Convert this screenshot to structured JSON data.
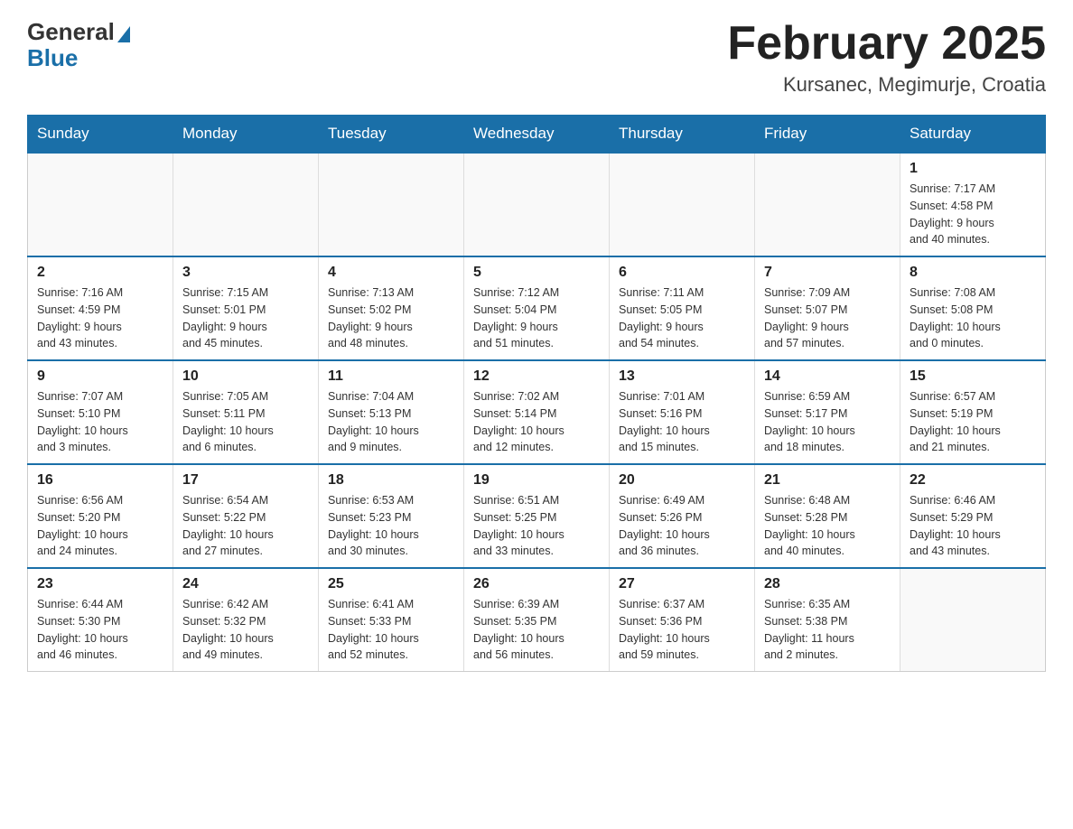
{
  "header": {
    "logo_general": "General",
    "logo_blue": "Blue",
    "title": "February 2025",
    "location": "Kursanec, Megimurje, Croatia"
  },
  "weekdays": [
    "Sunday",
    "Monday",
    "Tuesday",
    "Wednesday",
    "Thursday",
    "Friday",
    "Saturday"
  ],
  "weeks": [
    [
      {
        "day": "",
        "info": ""
      },
      {
        "day": "",
        "info": ""
      },
      {
        "day": "",
        "info": ""
      },
      {
        "day": "",
        "info": ""
      },
      {
        "day": "",
        "info": ""
      },
      {
        "day": "",
        "info": ""
      },
      {
        "day": "1",
        "info": "Sunrise: 7:17 AM\nSunset: 4:58 PM\nDaylight: 9 hours\nand 40 minutes."
      }
    ],
    [
      {
        "day": "2",
        "info": "Sunrise: 7:16 AM\nSunset: 4:59 PM\nDaylight: 9 hours\nand 43 minutes."
      },
      {
        "day": "3",
        "info": "Sunrise: 7:15 AM\nSunset: 5:01 PM\nDaylight: 9 hours\nand 45 minutes."
      },
      {
        "day": "4",
        "info": "Sunrise: 7:13 AM\nSunset: 5:02 PM\nDaylight: 9 hours\nand 48 minutes."
      },
      {
        "day": "5",
        "info": "Sunrise: 7:12 AM\nSunset: 5:04 PM\nDaylight: 9 hours\nand 51 minutes."
      },
      {
        "day": "6",
        "info": "Sunrise: 7:11 AM\nSunset: 5:05 PM\nDaylight: 9 hours\nand 54 minutes."
      },
      {
        "day": "7",
        "info": "Sunrise: 7:09 AM\nSunset: 5:07 PM\nDaylight: 9 hours\nand 57 minutes."
      },
      {
        "day": "8",
        "info": "Sunrise: 7:08 AM\nSunset: 5:08 PM\nDaylight: 10 hours\nand 0 minutes."
      }
    ],
    [
      {
        "day": "9",
        "info": "Sunrise: 7:07 AM\nSunset: 5:10 PM\nDaylight: 10 hours\nand 3 minutes."
      },
      {
        "day": "10",
        "info": "Sunrise: 7:05 AM\nSunset: 5:11 PM\nDaylight: 10 hours\nand 6 minutes."
      },
      {
        "day": "11",
        "info": "Sunrise: 7:04 AM\nSunset: 5:13 PM\nDaylight: 10 hours\nand 9 minutes."
      },
      {
        "day": "12",
        "info": "Sunrise: 7:02 AM\nSunset: 5:14 PM\nDaylight: 10 hours\nand 12 minutes."
      },
      {
        "day": "13",
        "info": "Sunrise: 7:01 AM\nSunset: 5:16 PM\nDaylight: 10 hours\nand 15 minutes."
      },
      {
        "day": "14",
        "info": "Sunrise: 6:59 AM\nSunset: 5:17 PM\nDaylight: 10 hours\nand 18 minutes."
      },
      {
        "day": "15",
        "info": "Sunrise: 6:57 AM\nSunset: 5:19 PM\nDaylight: 10 hours\nand 21 minutes."
      }
    ],
    [
      {
        "day": "16",
        "info": "Sunrise: 6:56 AM\nSunset: 5:20 PM\nDaylight: 10 hours\nand 24 minutes."
      },
      {
        "day": "17",
        "info": "Sunrise: 6:54 AM\nSunset: 5:22 PM\nDaylight: 10 hours\nand 27 minutes."
      },
      {
        "day": "18",
        "info": "Sunrise: 6:53 AM\nSunset: 5:23 PM\nDaylight: 10 hours\nand 30 minutes."
      },
      {
        "day": "19",
        "info": "Sunrise: 6:51 AM\nSunset: 5:25 PM\nDaylight: 10 hours\nand 33 minutes."
      },
      {
        "day": "20",
        "info": "Sunrise: 6:49 AM\nSunset: 5:26 PM\nDaylight: 10 hours\nand 36 minutes."
      },
      {
        "day": "21",
        "info": "Sunrise: 6:48 AM\nSunset: 5:28 PM\nDaylight: 10 hours\nand 40 minutes."
      },
      {
        "day": "22",
        "info": "Sunrise: 6:46 AM\nSunset: 5:29 PM\nDaylight: 10 hours\nand 43 minutes."
      }
    ],
    [
      {
        "day": "23",
        "info": "Sunrise: 6:44 AM\nSunset: 5:30 PM\nDaylight: 10 hours\nand 46 minutes."
      },
      {
        "day": "24",
        "info": "Sunrise: 6:42 AM\nSunset: 5:32 PM\nDaylight: 10 hours\nand 49 minutes."
      },
      {
        "day": "25",
        "info": "Sunrise: 6:41 AM\nSunset: 5:33 PM\nDaylight: 10 hours\nand 52 minutes."
      },
      {
        "day": "26",
        "info": "Sunrise: 6:39 AM\nSunset: 5:35 PM\nDaylight: 10 hours\nand 56 minutes."
      },
      {
        "day": "27",
        "info": "Sunrise: 6:37 AM\nSunset: 5:36 PM\nDaylight: 10 hours\nand 59 minutes."
      },
      {
        "day": "28",
        "info": "Sunrise: 6:35 AM\nSunset: 5:38 PM\nDaylight: 11 hours\nand 2 minutes."
      },
      {
        "day": "",
        "info": ""
      }
    ]
  ]
}
